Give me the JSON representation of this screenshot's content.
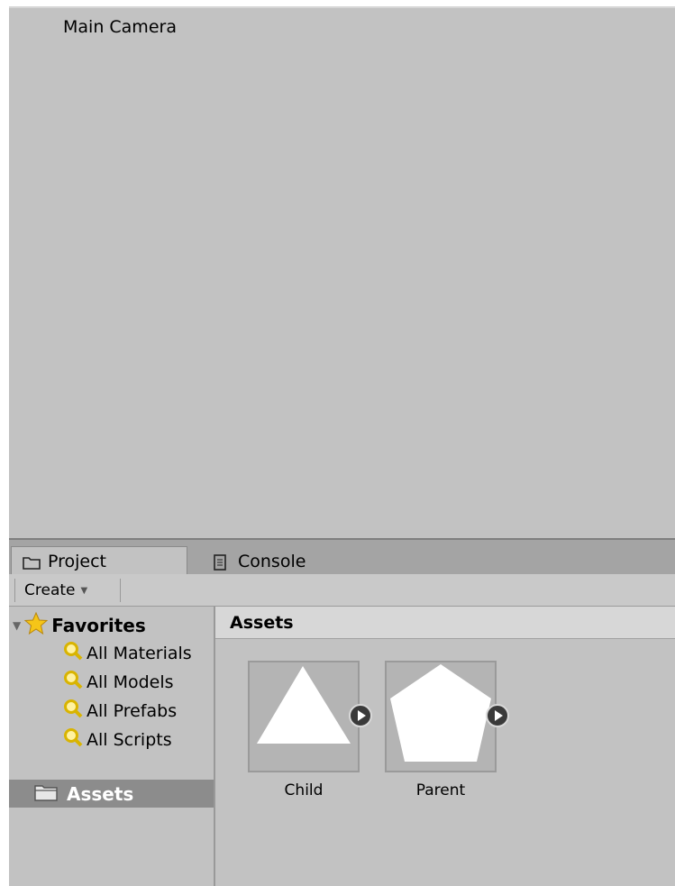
{
  "hierarchy": {
    "items": [
      "Main Camera"
    ]
  },
  "tabs": [
    {
      "label": "Project",
      "icon": "folder-icon",
      "active": true
    },
    {
      "label": "Console",
      "icon": "console-icon",
      "active": false
    }
  ],
  "toolbar": {
    "create_label": "Create"
  },
  "tree": {
    "favorites_label": "Favorites",
    "searches": [
      "All Materials",
      "All Models",
      "All Prefabs",
      "All Scripts"
    ],
    "assets_label": "Assets"
  },
  "assets_panel": {
    "header": "Assets",
    "items": [
      {
        "label": "Child",
        "shape": "triangle"
      },
      {
        "label": "Parent",
        "shape": "pentagon"
      }
    ]
  },
  "colors": {
    "panel_bg": "#c2c2c2",
    "tab_bar": "#a4a4a4",
    "selected_row": "#8c8c8c",
    "search_icon": "#d9b400"
  }
}
